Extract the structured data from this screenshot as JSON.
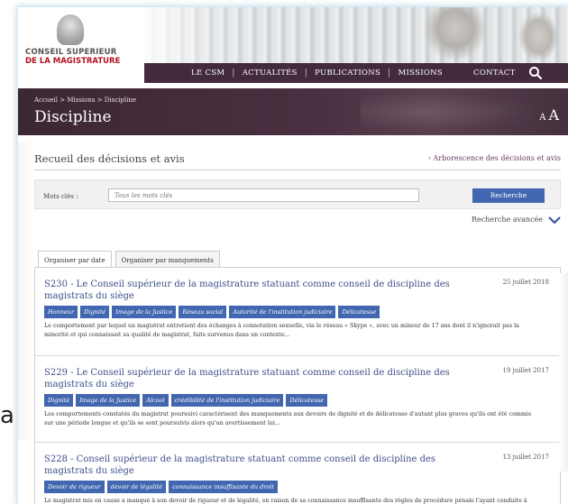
{
  "header": {
    "logo_line1": "CONSEIL SUPERIEUR",
    "logo_line2": "DE LA MAGISTRATURE",
    "nav": [
      "LE CSM",
      "ACTUALITÉS",
      "PUBLICATIONS",
      "MISSIONS",
      "CONTACT"
    ],
    "nav_separator": "|"
  },
  "banner": {
    "breadcrumb": "Accueil > Missions > Discipline",
    "title": "Discipline",
    "font_small": "A",
    "font_large": "A"
  },
  "main": {
    "section_title": "Recueil des décisions et avis",
    "tree_link": "› Arborescence des décisions et avis",
    "search": {
      "label": "Mots clés :",
      "placeholder": "Tous les mots clés",
      "button": "Recherche",
      "advanced": "Recherche avancée"
    },
    "tabs": [
      "Organiser par date",
      "Organiser par manquements"
    ],
    "items": [
      {
        "title": "S230 - Le Conseil supérieur de la magistrature statuant comme conseil de discipline des magistrats du siège",
        "date": "25 juillet 2018",
        "tags": [
          "Honneur",
          "Dignité",
          "Image de la Justice",
          "Réseau social",
          "Autorité de l'institution judiciaire",
          "Délicatesse"
        ],
        "desc": "Le comportement par lequel un magistrat entretient des échanges à connotation sexuelle, via le réseau « Skype », avec un mineur de 17 ans dont il n'ignorait pas la minorité et qui connaissait sa qualité de magistrat, faits survenus dans un contexte..."
      },
      {
        "title": "S229 - Le Conseil supérieur de la magistrature statuant comme conseil de discipline des magistrats du siège",
        "date": "19 juillet 2017",
        "tags": [
          "Dignité",
          "Image de la Justice",
          "Alcool",
          "crédibilité de l'institution judiciaire",
          "Délicatesse"
        ],
        "desc": "Les comportements constatés du magistrat poursuivi caractérisent des manquements aux devoirs de dignité et de délicatesse d'autant plus graves qu'ils ont été commis sur une période longue et qu'ils se sont poursuivis alors qu'un avertissement lui..."
      },
      {
        "title": "S228 - Conseil supérieur de la magistrature statuant comme conseil de discipline des magistrats du siège",
        "date": "13 juillet 2017",
        "tags": [
          "Devoir de rigueur",
          "devoir de légalité",
          "connaissance insuffisante du droit"
        ],
        "desc": "Le magistrat mis en cause a manqué à son devoir de rigueur et de légalité, en raison de sa connaissance insuffisante des règles de procédure pénale l'ayant conduite à prendre le risque de commettre une erreur sur une question fondamentale et..."
      }
    ]
  },
  "stray_text": "a",
  "colors": {
    "nav_bg": "#432a3c",
    "banner_bg": "#4a3040",
    "accent_blue": "#4267b0",
    "logo_red": "#b3121f",
    "title_blue": "#3c4f8a"
  },
  "icons": {
    "search": "search-icon",
    "chevron": "chevron-down-icon"
  }
}
